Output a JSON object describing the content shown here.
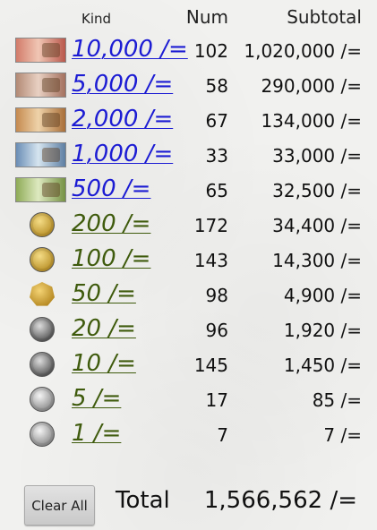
{
  "header": {
    "kind": "Kind",
    "num": "Num",
    "subtotal": "Subtotal"
  },
  "rows": [
    {
      "kind": "10,000 /=",
      "num": "102",
      "subtotal": "1,020,000 /=",
      "icon": "banknote-10000-icon"
    },
    {
      "kind": "5,000 /=",
      "num": "58",
      "subtotal": "290,000 /=",
      "icon": "banknote-5000-icon"
    },
    {
      "kind": "2,000 /=",
      "num": "67",
      "subtotal": "134,000 /=",
      "icon": "banknote-2000-icon"
    },
    {
      "kind": "1,000 /=",
      "num": "33",
      "subtotal": "33,000 /=",
      "icon": "banknote-1000-icon"
    },
    {
      "kind": "500 /=",
      "num": "65",
      "subtotal": "32,500 /=",
      "icon": "banknote-500-icon"
    },
    {
      "kind": "200 /=",
      "num": "172",
      "subtotal": "34,400 /=",
      "icon": "coin-200-icon"
    },
    {
      "kind": "100 /=",
      "num": "143",
      "subtotal": "14,300 /=",
      "icon": "coin-100-icon"
    },
    {
      "kind": "50 /=",
      "num": "98",
      "subtotal": "4,900 /=",
      "icon": "coin-50-icon"
    },
    {
      "kind": "20 /=",
      "num": "96",
      "subtotal": "1,920 /=",
      "icon": "coin-20-icon"
    },
    {
      "kind": "10 /=",
      "num": "145",
      "subtotal": "1,450 /=",
      "icon": "coin-10-icon"
    },
    {
      "kind": "5 /=",
      "num": "17",
      "subtotal": "85 /=",
      "icon": "coin-5-icon"
    },
    {
      "kind": "1 /=",
      "num": "7",
      "subtotal": "7 /=",
      "icon": "coin-1-icon"
    }
  ],
  "footer": {
    "clear_label": "Clear All",
    "total_label": "Total",
    "total_value": "1,566,562 /="
  },
  "colors": {
    "note_link": "#1c1cd3",
    "coin_link": "#3f5b0d",
    "background": "#f1f1ef"
  }
}
